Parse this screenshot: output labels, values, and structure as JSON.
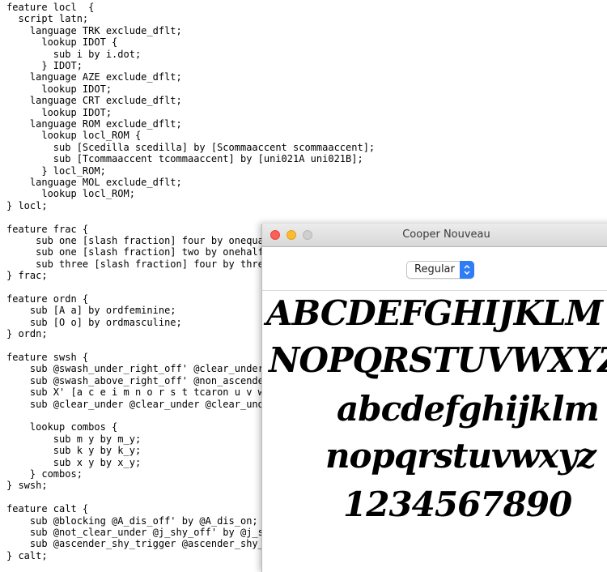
{
  "code_lines": [
    "feature locl  {",
    "  script latn;",
    "    language TRK exclude_dflt;",
    "      lookup IDOT {",
    "        sub i by i.dot;",
    "      } IDOT;",
    "    language AZE exclude_dflt;",
    "      lookup IDOT;",
    "    language CRT exclude_dflt;",
    "      lookup IDOT;",
    "    language ROM exclude_dflt;",
    "      lookup locl_ROM {",
    "        sub [Scedilla scedilla] by [Scommaaccent scommaaccent];",
    "        sub [Tcommaaccent tcommaaccent] by [uni021A uni021B];",
    "      } locl_ROM;",
    "    language MOL exclude_dflt;",
    "      lookup locl_ROM;",
    "} locl;",
    "",
    "feature frac {",
    "     sub one [slash fraction] four by onequarter;",
    "     sub one [slash fraction] two by onehalf;",
    "     sub three [slash fraction] four by threequarters;",
    "} frac;",
    "",
    "feature ordn {",
    "    sub [A a] by ordfeminine;",
    "    sub [O o] by ordmasculine;",
    "} ordn;",
    "",
    "feature swsh {",
    "    sub @swash_under_right_off' @clear_under by @swash_under_right_on;",
    "    sub @swash_above_right_off' @non_ascender by @swash_above_right_on;",
    "    sub X' [a c e i m n o r s t tcaron u v w x z] by X.alt;",
    "    sub @clear_under @clear_under @clear_under by @clear_under;",
    "",
    "    lookup combos {",
    "        sub m y by m_y;",
    "        sub k y by k_y;",
    "        sub x y by x_y;",
    "    } combos;",
    "} swsh;",
    "",
    "feature calt {",
    "    sub @blocking @A_dis_off' by @A_dis_on;",
    "    sub @not_clear_under @j_shy_off' by @j_shy_on;",
    "    sub @ascender_shy_trigger @ascender_shy_off' by @ascender_shy_on;",
    "} calt;"
  ],
  "preview_window": {
    "title": "Cooper Nouveau",
    "style_select": {
      "selected": "Regular"
    },
    "glyph_rows": [
      "ABCDEFGHIJKLM",
      "NOPQRSTUVWXYZ",
      "abcdefghijklm",
      "nopqrstuvwxyz",
      "1234567890"
    ]
  },
  "colors": {
    "close_button": "#fc5f57",
    "minimize_button": "#fdbc2e",
    "zoom_button_inactive": "#cfcfcf",
    "stepper_accent": "#2f7cf6"
  }
}
